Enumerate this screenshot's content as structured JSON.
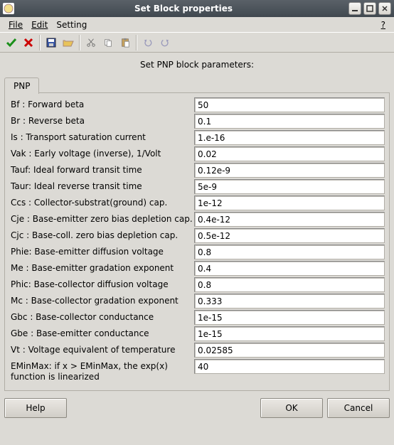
{
  "window": {
    "title": "Set Block properties"
  },
  "menu": {
    "file": "File",
    "edit": "Edit",
    "setting": "Setting",
    "help": "?"
  },
  "header": {
    "label": "Set PNP block parameters:"
  },
  "tab": {
    "label": "PNP"
  },
  "params": [
    {
      "label": "Bf  : Forward beta",
      "value": "50"
    },
    {
      "label": "Br  : Reverse beta",
      "value": "0.1"
    },
    {
      "label": "Is  : Transport saturation current",
      "value": "1.e-16"
    },
    {
      "label": "Vak : Early voltage (inverse), 1/Volt",
      "value": "0.02"
    },
    {
      "label": "Tauf: Ideal forward transit time",
      "value": "0.12e-9"
    },
    {
      "label": "Taur: Ideal reverse transit time",
      "value": "5e-9"
    },
    {
      "label": "Ccs : Collector-substrat(ground) cap.",
      "value": "1e-12"
    },
    {
      "label": "Cje : Base-emitter zero bias depletion cap.",
      "value": "0.4e-12"
    },
    {
      "label": "Cjc : Base-coll. zero bias depletion cap.",
      "value": "0.5e-12"
    },
    {
      "label": "Phie: Base-emitter diffusion voltage",
      "value": "0.8"
    },
    {
      "label": "Me  : Base-emitter gradation exponent",
      "value": "0.4"
    },
    {
      "label": "Phic: Base-collector diffusion voltage",
      "value": "0.8"
    },
    {
      "label": "Mc  : Base-collector gradation exponent",
      "value": "0.333"
    },
    {
      "label": "Gbc : Base-collector conductance",
      "value": "1e-15"
    },
    {
      "label": "Gbe : Base-emitter conductance",
      "value": "1e-15"
    },
    {
      "label": "Vt  : Voltage equivalent of temperature",
      "value": "0.02585"
    },
    {
      "label": "EMinMax: if x > EMinMax, the exp(x) function is linearized",
      "value": "40"
    }
  ],
  "buttons": {
    "help": "Help",
    "ok": "OK",
    "cancel": "Cancel"
  },
  "icons": {
    "accept": "accept-icon",
    "cancel_x": "cancel-icon",
    "save": "save-icon",
    "open": "open-icon",
    "cut": "cut-icon",
    "copy": "copy-icon",
    "paste": "paste-icon",
    "undo": "undo-icon",
    "redo": "redo-icon"
  }
}
